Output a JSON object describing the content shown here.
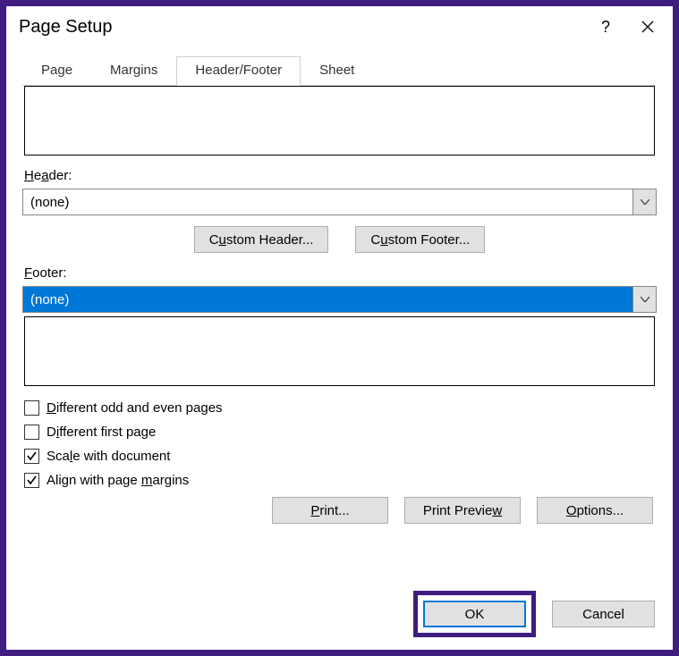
{
  "dialog": {
    "title": "Page Setup",
    "help": "?"
  },
  "tabs": {
    "page": "Page",
    "margins": "Margins",
    "headerfooter": "Header/Footer",
    "sheet": "Sheet"
  },
  "labels": {
    "header": "Header:",
    "footer": "Footer:"
  },
  "header_value": "(none)",
  "footer_value": "(none)",
  "buttons": {
    "custom_header_pre": "C",
    "custom_header_u": "u",
    "custom_header_post": "stom Header...",
    "custom_footer_pre": "C",
    "custom_footer_u": "u",
    "custom_footer_post": "stom Footer...",
    "print_u": "P",
    "print_post": "rint...",
    "preview_pre": "Print Previe",
    "preview_u": "w",
    "options_u": "O",
    "options_post": "ptions...",
    "ok": "OK",
    "cancel": "Cancel"
  },
  "checks": {
    "diff_odd_pre": "",
    "diff_odd_u": "D",
    "diff_odd_post": "ifferent odd and even pages",
    "diff_first_pre": "D",
    "diff_first_u": "i",
    "diff_first_post": "fferent first page",
    "scale_pre": "Sca",
    "scale_u": "l",
    "scale_post": "e with document",
    "align_pre": "Align with page ",
    "align_u": "m",
    "align_post": "argins"
  }
}
